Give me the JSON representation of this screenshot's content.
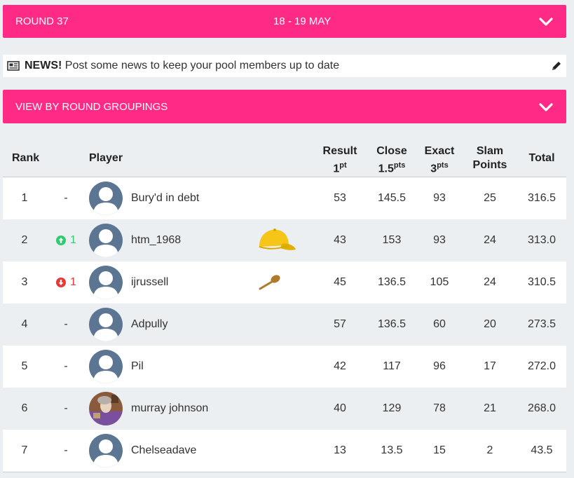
{
  "round_bar": {
    "round": "ROUND 37",
    "dates": "18 - 19 MAY"
  },
  "news": {
    "label": "NEWS!",
    "text": "Post some news to keep your pool members up to date"
  },
  "groupings_bar": {
    "label": "VIEW BY ROUND GROUPINGS"
  },
  "table": {
    "headers": {
      "rank": "Rank",
      "player": "Player",
      "result": "Result",
      "result_num": "1",
      "result_unit": "pt",
      "close": "Close",
      "close_num": "1.5",
      "close_unit": "pts",
      "exact": "Exact",
      "exact_num": "3",
      "exact_unit": "pts",
      "slam": "Slam",
      "slam2": "Points",
      "total": "Total"
    },
    "rows": [
      {
        "rank": "1",
        "move": "-",
        "player": "Bury'd in debt",
        "result": "53",
        "close": "145.5",
        "exact": "93",
        "slam": "25",
        "total": "316.5"
      },
      {
        "rank": "2",
        "move": "1",
        "player": "htm_1968",
        "result": "43",
        "close": "153",
        "exact": "93",
        "slam": "24",
        "total": "313.0"
      },
      {
        "rank": "3",
        "move": "1",
        "player": "ijrussell",
        "result": "45",
        "close": "136.5",
        "exact": "105",
        "slam": "24",
        "total": "310.5"
      },
      {
        "rank": "4",
        "move": "-",
        "player": "Adpully",
        "result": "57",
        "close": "136.5",
        "exact": "60",
        "slam": "20",
        "total": "273.5"
      },
      {
        "rank": "5",
        "move": "-",
        "player": "Pil",
        "result": "42",
        "close": "117",
        "exact": "96",
        "slam": "17",
        "total": "272.0"
      },
      {
        "rank": "6",
        "move": "-",
        "player": "murray johnson",
        "result": "40",
        "close": "129",
        "exact": "78",
        "slam": "21",
        "total": "268.0"
      },
      {
        "rank": "7",
        "move": "-",
        "player": "Chelseadave",
        "result": "13",
        "close": "13.5",
        "exact": "15",
        "slam": "2",
        "total": "43.5"
      }
    ]
  },
  "colors": {
    "accent": "#ff2a85",
    "up": "#2ecc71",
    "down": "#e53935",
    "cap": "#f5c518",
    "spoon": "#b07a2a"
  }
}
